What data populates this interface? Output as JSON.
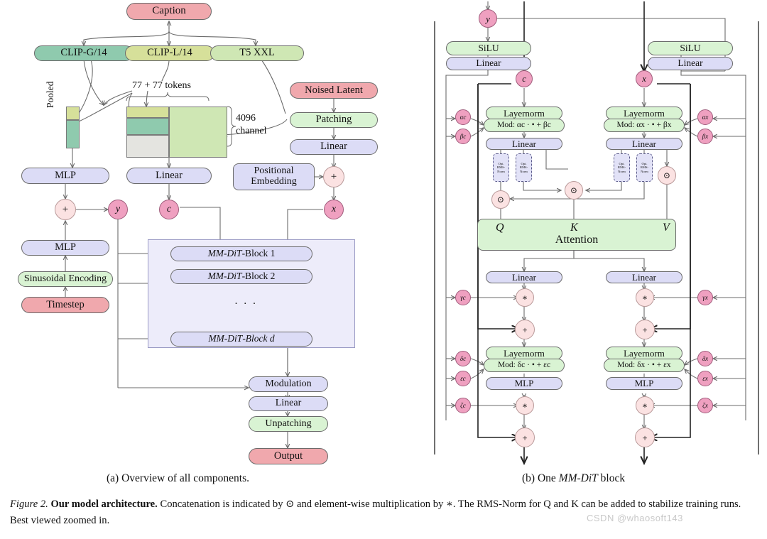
{
  "figure": {
    "label": "Figure 2.",
    "bold_title": "Our model architecture.",
    "body": " Concatenation is indicated by ⊙ and element-wise multiplication by ∗. The RMS-Norm for Q and K can be added to stabilize training runs. Best viewed zoomed in.",
    "watermark": "CSDN @whaosoft143"
  },
  "subcaptions": {
    "a": "(a) Overview of all components.",
    "b_prefix": "(b) One ",
    "b_italic": "MM-DiT",
    "b_suffix": " block"
  },
  "panel_a": {
    "caption_box": "Caption",
    "encoders": [
      {
        "label": "CLIP-G/14",
        "color": "#8fcaae"
      },
      {
        "label": "CLIP-L/14",
        "color": "#d6e09a"
      },
      {
        "label": "T5 XXL",
        "color": "#cfe7b4"
      }
    ],
    "annotations": {
      "tokens": "77 + 77 tokens",
      "channel_line1": "4096",
      "channel_line2": "channel",
      "pooled": "Pooled"
    },
    "left_column": [
      {
        "label": "MLP",
        "color": "#dcdcf6"
      },
      {
        "label": "MLP",
        "color": "#dcdcf6"
      },
      {
        "label": "Sinusoidal Encoding",
        "color": "#d9f3d3"
      },
      {
        "label": "Timestep",
        "color": "#f0a8ad"
      }
    ],
    "mid_column": [
      {
        "label": "Linear",
        "color": "#dcdcf6"
      }
    ],
    "right_column": [
      {
        "label": "Noised Latent",
        "color": "#f0a8ad"
      },
      {
        "label": "Patching",
        "color": "#d9f3d3"
      },
      {
        "label": "Linear",
        "color": "#dcdcf6"
      }
    ],
    "positional_embedding": {
      "line1": "Positional",
      "line2": "Embedding"
    },
    "vars": {
      "y": "y",
      "c": "c",
      "x": "x",
      "plus": "+"
    },
    "blocks": [
      "MM-DiT-Block 1",
      "MM-DiT-Block 2",
      "MM-DiT-Block d"
    ],
    "blocks_parts": [
      {
        "italic": "MM-DiT",
        "rest": "-Block 1"
      },
      {
        "italic": "MM-DiT",
        "rest": "-Block 2"
      },
      {
        "italic": "MM-DiT",
        "rest": "-Block d"
      }
    ],
    "ellipsis": "· · ·",
    "tail": [
      {
        "label": "Modulation",
        "color": "#dcdcf6"
      },
      {
        "label": "Linear",
        "color": "#dcdcf6"
      },
      {
        "label": "Unpatching",
        "color": "#d9f3d3"
      },
      {
        "label": "Output",
        "color": "#f0a8ad"
      }
    ]
  },
  "panel_b": {
    "top_var": "y",
    "silu": "SiLU",
    "linear": "Linear",
    "layernorm": "Layernorm",
    "mlp": "MLP",
    "attention": "Attention",
    "qkv": [
      "Q",
      "K",
      "V"
    ],
    "rms_norm": {
      "l1": "Opt.",
      "l2": "RMS-",
      "l3": "Norm"
    },
    "c_var": "c",
    "x_var": "x",
    "mod_c_attn": "Mod: αc · • + βc",
    "mod_x_attn": "Mod: αx · • + βx",
    "mod_c_mlp": "Mod: δc · • + εc",
    "mod_x_mlp": "Mod: δx · • + εx",
    "params_left": [
      "αc",
      "βc",
      "γc",
      "δc",
      "εc",
      "ζc"
    ],
    "params_right": [
      "αx",
      "βx",
      "γx",
      "δx",
      "εx",
      "ζx"
    ],
    "ops": {
      "concat": "⊙",
      "mul": "∗",
      "add": "+"
    }
  },
  "colors": {
    "pink": "#f0a8ad",
    "blue": "#dcdcf6",
    "green": "#d9f3d3",
    "teal": "#8fcaae",
    "olive": "#d6e09a",
    "light_green": "#cfe7b4",
    "deep_pink_node": "#efa0c0",
    "pale_pink_node": "#fbe2e2",
    "plate": "#edecfa",
    "stroke": "#6b6b6b"
  }
}
